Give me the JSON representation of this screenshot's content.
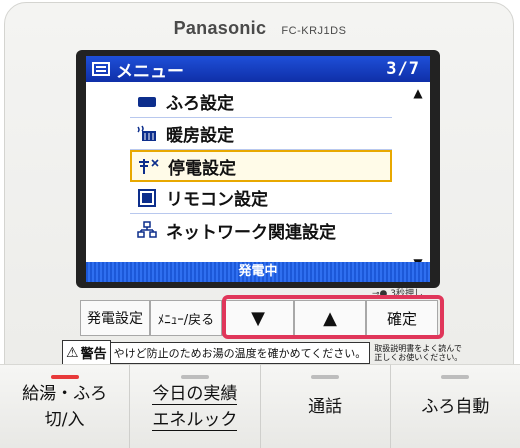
{
  "brand": {
    "name": "Panasonic",
    "model": "FC-KRJ1DS"
  },
  "screen": {
    "title": "メニュー",
    "page": "3/7",
    "items": [
      {
        "label": "ふろ設定",
        "icon": "bath-icon"
      },
      {
        "label": "暖房設定",
        "icon": "heater-icon"
      },
      {
        "label": "停電設定",
        "icon": "power-outage-icon",
        "selected": true
      },
      {
        "label": "リモコン設定",
        "icon": "remote-icon"
      },
      {
        "label": "ネットワーク関連設定",
        "icon": "network-icon"
      }
    ],
    "status": "発電中",
    "scroll_up": "▲",
    "scroll_down": "▼"
  },
  "hold_label": "3秒押し",
  "buttons": {
    "generation": "発電設定",
    "menu_back": "ﾒﾆｭｰ/戻る",
    "down": "▼",
    "up": "▲",
    "confirm": "確定"
  },
  "warning": {
    "label": "警告",
    "text": "やけど防止のためお湯の温度を確かめてください。",
    "note_line1": "取扱説明書をよく読んで",
    "note_line2": "正しくお使いください。"
  },
  "bottom_keys": [
    {
      "line1": "給湯・ふろ",
      "line2": "切/入"
    },
    {
      "line1": "今日の実績",
      "line2": "エネルック"
    },
    {
      "line1": "通話",
      "line2": ""
    },
    {
      "line1": "ふろ自動",
      "line2": ""
    }
  ],
  "colors": {
    "screen_header": "#1e4fd8",
    "selection": "#e8a800",
    "highlight": "#e0365a",
    "status_indicator": "#e83a3a"
  }
}
